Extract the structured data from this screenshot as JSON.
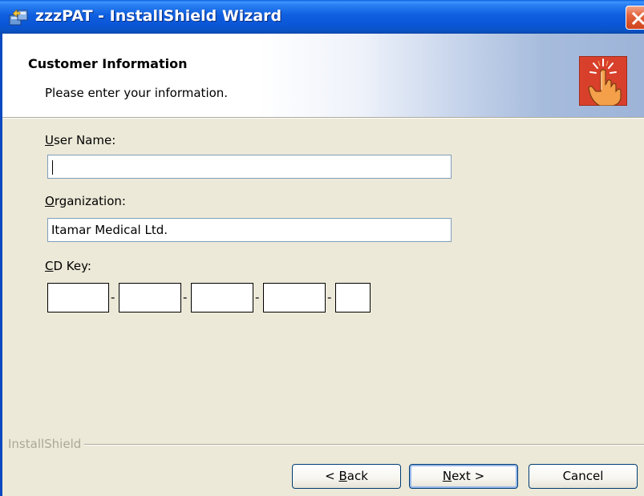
{
  "window": {
    "title": "zzzPAT - InstallShield Wizard",
    "title_icon": "installer-package-icon",
    "close_icon": "close-icon"
  },
  "header": {
    "title": "Customer Information",
    "subtitle": "Please enter your information.",
    "graphic_icon": "pointing-hand-icon"
  },
  "form": {
    "user_name": {
      "label_underlined": "U",
      "label_rest": "ser Name:",
      "value": ""
    },
    "organization": {
      "label_underlined": "O",
      "label_rest": "rganization:",
      "value": "Itamar Medical Ltd."
    },
    "cd_key": {
      "label_underlined": "C",
      "label_rest": "D Key:",
      "segments": [
        "",
        "",
        "",
        "",
        ""
      ],
      "separator": "-"
    }
  },
  "brand": {
    "text": "InstallShield"
  },
  "buttons": {
    "back": {
      "prefix": "< ",
      "underlined": "B",
      "rest": "ack"
    },
    "next": {
      "underlined": "N",
      "rest": "ext >"
    },
    "cancel": {
      "label": "Cancel"
    }
  },
  "colors": {
    "titlebar": "#0a56d6",
    "dialog_bg": "#ece9d8",
    "close_button": "#d0431a",
    "field_border": "#7f9db9"
  }
}
